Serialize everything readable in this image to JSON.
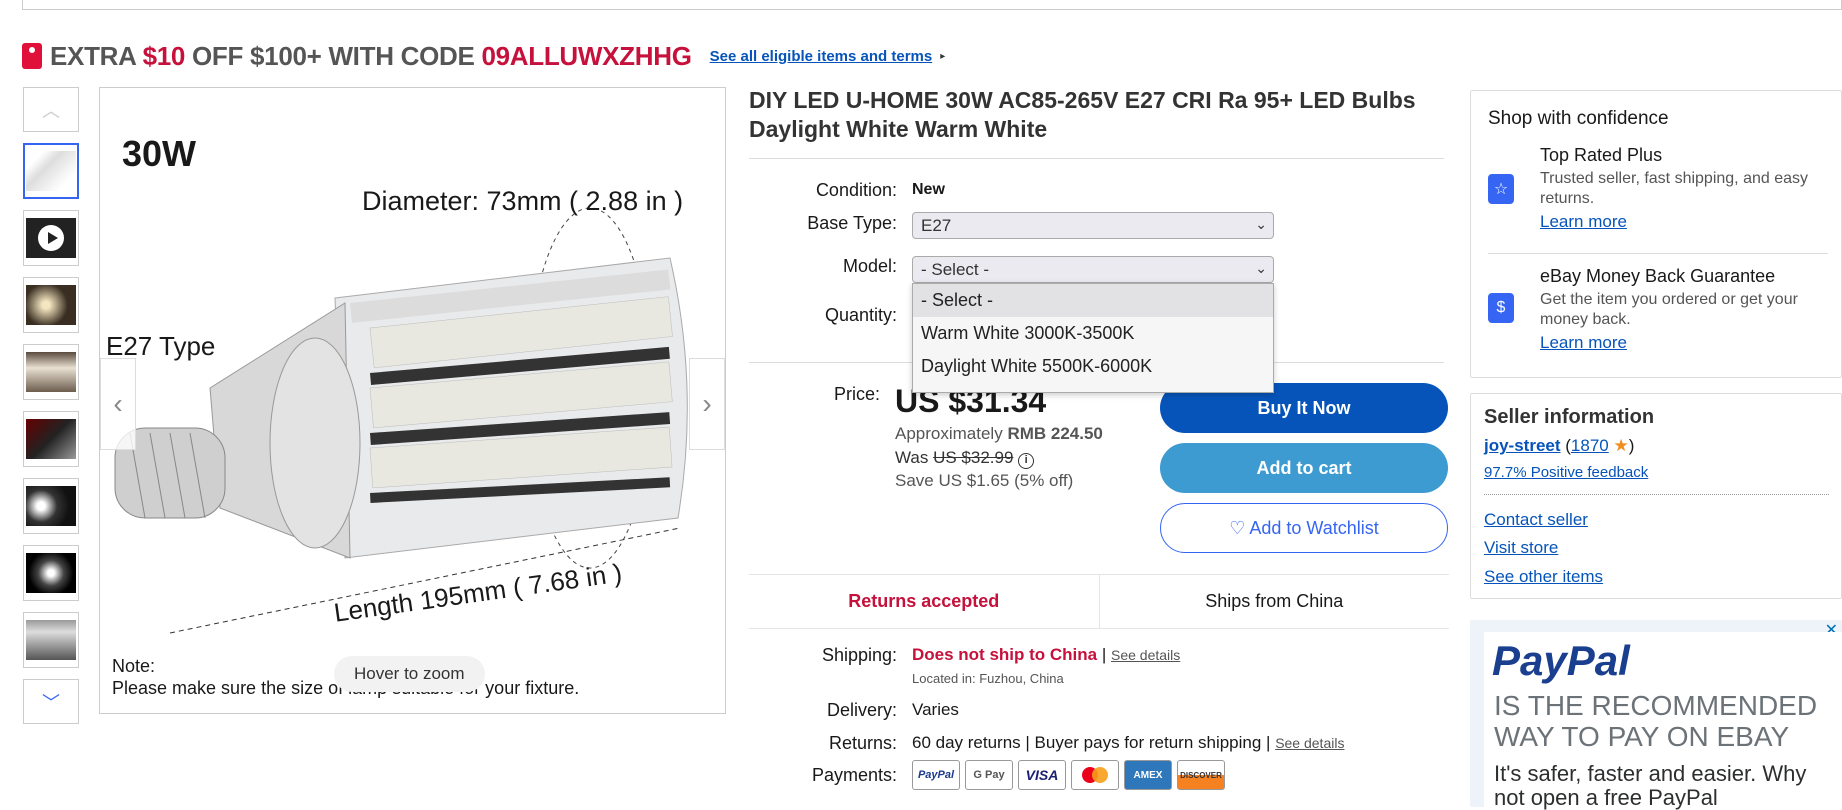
{
  "promo": {
    "prefix": "EXTRA ",
    "amount": "$10",
    "middle": " OFF $100+ WITH CODE ",
    "code": "09ALLUWXZHHG",
    "link": "See all eligible items and terms",
    "link_arrow": "▸"
  },
  "gallery": {
    "up_arrow": "︿",
    "down_arrow": "﹀",
    "prev_arrow": "‹",
    "next_arrow": "›",
    "hover_zoom": "Hover to zoom",
    "image_text": {
      "watt": "30W",
      "diameter": "Diameter: 73mm ( 2.88 in )",
      "type": "E27 Type",
      "length": "Length 195mm ( 7.68 in )",
      "note_title": "Note:",
      "note": "Please make sure the size of lamp suitable for your fixture."
    }
  },
  "product": {
    "title": "DIY LED U-HOME 30W AC85-265V E27 CRI Ra 95+ LED Bulbs Daylight White Warm White",
    "condition_label": "Condition:",
    "condition_value": "New",
    "base_label": "Base Type:",
    "base_value": "E27",
    "model_label": "Model:",
    "model_value": "- Select -",
    "quantity_label": "Quantity:",
    "model_options": [
      "- Select -",
      "Warm White 3000K-3500K",
      "Daylight White 5500K-6000K"
    ]
  },
  "price": {
    "label": "Price:",
    "value": "US $31.34",
    "approx_prefix": "Approximately ",
    "approx_value": "RMB 224.50",
    "was_label": "Was ",
    "was_value": "US $32.99",
    "save": "Save US $1.65 (5% off)"
  },
  "buttons": {
    "buy": "Buy It Now",
    "cart": "Add to cart",
    "watch": "♡ Add to Watchlist"
  },
  "shipping_bar": {
    "returns": "Returns accepted",
    "ships": "Ships from China"
  },
  "shipping": {
    "label": "Shipping:",
    "value": "Does not ship to China",
    "sep": " | ",
    "details": "See details",
    "location": "Located in: Fuzhou, China",
    "delivery_label": "Delivery:",
    "delivery_value": "Varies",
    "returns_label": "Returns:",
    "returns_value": "60 day returns | Buyer pays for return shipping | ",
    "returns_details": "See details",
    "payments_label": "Payments:"
  },
  "payments": [
    "PayPal",
    "G Pay",
    "VISA",
    "",
    "AMEX",
    "DISCOVER"
  ],
  "confidence": {
    "title": "Shop with confidence",
    "f1_title": "Top Rated Plus",
    "f1_desc": "Trusted seller, fast shipping, and easy returns.",
    "f1_link": "Learn more",
    "f2_title": "eBay Money Back Guarantee",
    "f2_desc": "Get the item you ordered or get your money back.",
    "f2_link": "Learn more"
  },
  "seller": {
    "title": "Seller information",
    "name": "joy-street",
    "open": " (",
    "count": "1870",
    "close": ")",
    "feedback": "97.7% Positive feedback",
    "contact": "Contact seller",
    "store": "Visit store",
    "other": "See other items"
  },
  "ad": {
    "close": "✕",
    "logo": "PayPal",
    "line1": "IS THE RECOMMENDED WAY TO PAY ON EBAY",
    "line2": "It's safer, faster and easier. Why not open a free PayPal"
  }
}
